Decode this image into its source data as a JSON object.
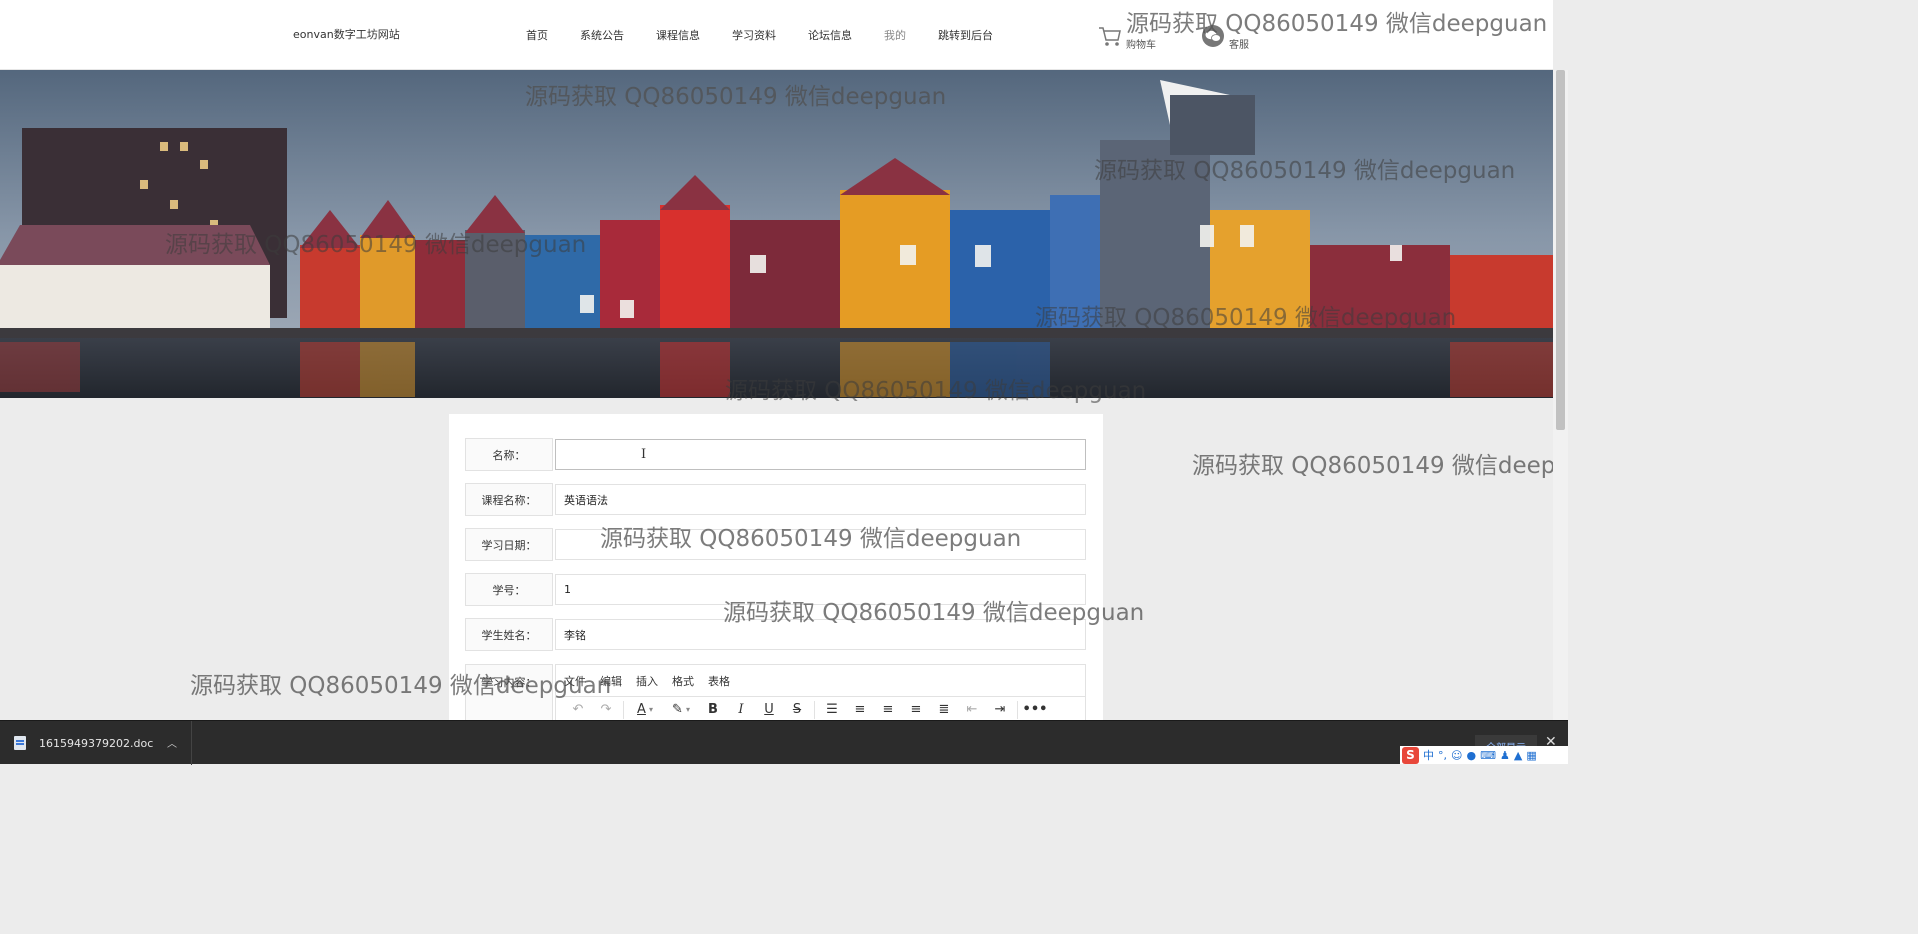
{
  "header": {
    "logo": "eonvan数字工坊网站",
    "nav": [
      "首页",
      "系统公告",
      "课程信息",
      "学习资料",
      "论坛信息",
      "我的",
      "跳转到后台"
    ],
    "cart_label": "购物车",
    "service_label": "客服"
  },
  "form": {
    "rows": [
      {
        "label": "名称：",
        "value": ""
      },
      {
        "label": "课程名称：",
        "value": "英语语法"
      },
      {
        "label": "学习日期：",
        "value": ""
      },
      {
        "label": "学号：",
        "value": "1"
      },
      {
        "label": "学生姓名：",
        "value": "李铭"
      }
    ],
    "content_label": "学习内容：",
    "editor_menu": [
      "文件",
      "编辑",
      "插入",
      "格式",
      "表格"
    ]
  },
  "watermark": "源码获取 QQ86050149 微信deepguan",
  "download": {
    "filename": "1615949379202.doc",
    "show_all": "全部显示"
  },
  "ime": {
    "lang": "中"
  }
}
